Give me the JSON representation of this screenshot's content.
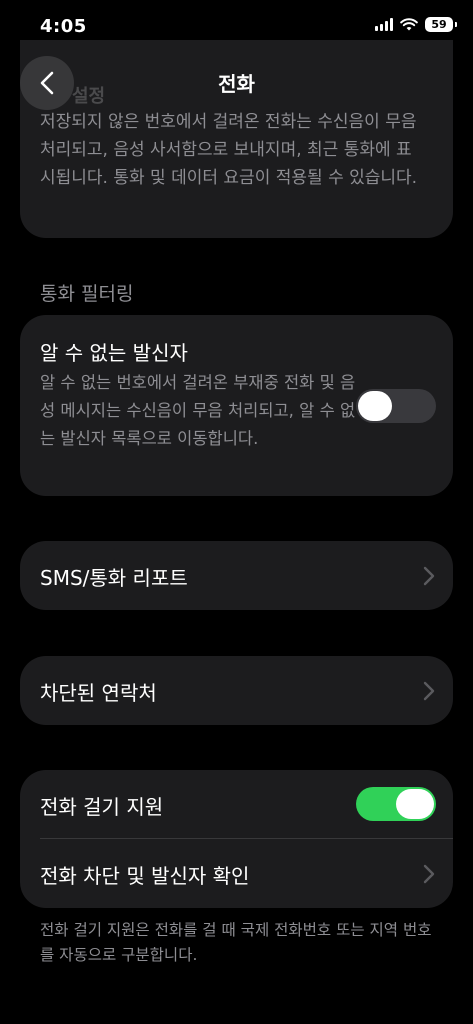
{
  "status_bar": {
    "time": "4:05",
    "battery": "59"
  },
  "nav": {
    "title": "전화"
  },
  "top_card": {
    "faded_title": "설정",
    "description": "저장되지 않은 번호에서 걸려온 전화는 수신음이 무음 처리되고, 음성 사서함으로 보내지며, 최근 통화에 표시됩니다. 통화 및 데이터 요금이 적용될 수 있습니다."
  },
  "call_filtering": {
    "header": "통화 필터링",
    "unknown_callers": {
      "label": "알 수 없는 발신자",
      "description": "알 수 없는 번호에서 걸려온 부재중 전화 및 음성 메시지는 수신음이 무음 처리되고, 알 수 없는 발신자 목록으로 이동합니다.",
      "enabled": false
    }
  },
  "rows": {
    "sms_report": "SMS/통화 리포트",
    "blocked_contacts": "차단된 연락처"
  },
  "dial_assist": {
    "label": "전화 걸기 지원",
    "enabled": true,
    "call_blocking_label": "전화 차단 및 발신자 확인",
    "footer": "전화 걸기 지원은 전화를 걸 때 국제 전화번호 또는 지역 번호를 자동으로 구분합니다."
  },
  "colors": {
    "toggle_on": "#30d158",
    "toggle_off": "#39393d",
    "card": "#1c1c1e"
  }
}
